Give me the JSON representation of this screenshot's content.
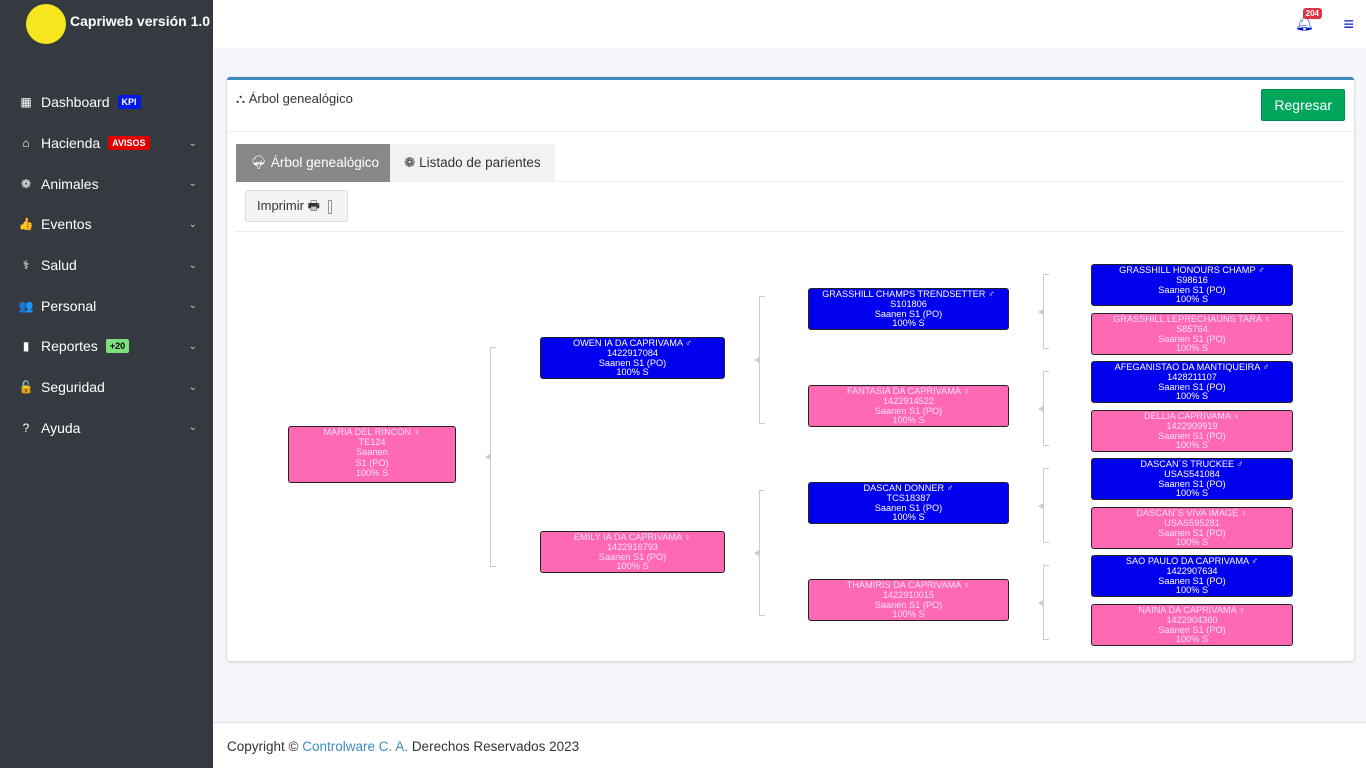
{
  "app": {
    "title": "Capriweb versión 1.0",
    "logo_text": "Capriweb"
  },
  "sidebar": {
    "items": [
      {
        "label": "Dashboard",
        "icon": "grid-icon",
        "glyph": "▦",
        "badge": "KPI",
        "badge_color": "#0019e6",
        "chev": false
      },
      {
        "label": "Hacienda",
        "icon": "home-icon",
        "glyph": "⌂",
        "badge": "AVISOS",
        "badge_color": "#e00000",
        "chev": true
      },
      {
        "label": "Animales",
        "icon": "paw-icon",
        "glyph": "❁",
        "chev": true
      },
      {
        "label": "Eventos",
        "icon": "thumbs-up-icon",
        "glyph": "👍",
        "chev": true
      },
      {
        "label": "Salud",
        "icon": "stethoscope-icon",
        "glyph": "⚕",
        "chev": true
      },
      {
        "label": "Personal",
        "icon": "users-icon",
        "glyph": "👥",
        "chev": true
      },
      {
        "label": "Reportes",
        "icon": "file-icon",
        "glyph": "▮",
        "badge": "+20",
        "badge_color": "#7ce07c",
        "chev": true
      },
      {
        "label": "Seguridad",
        "icon": "lock-icon",
        "glyph": "🔓",
        "chev": true
      },
      {
        "label": "Ayuda",
        "icon": "question-icon",
        "glyph": "?",
        "chev": true
      }
    ]
  },
  "topbar": {
    "notifications": "204"
  },
  "card": {
    "title": "Árbol genealógico",
    "back_button": "Regresar"
  },
  "tabs": {
    "tree": "Árbol genealógico",
    "relatives": "Listado de parientes"
  },
  "print_label": "Imprimir",
  "tree": {
    "nodes": [
      {
        "gen": 0,
        "name": "MARIA DEL RINCON",
        "sex": "f",
        "symbol": "♀",
        "lines": [
          "TE124",
          "Saanen",
          "S1 (PO)",
          "100% S"
        ]
      },
      {
        "gen": 1,
        "name": "OWEN IA DA CAPRIVAMA",
        "sex": "m",
        "symbol": "♂",
        "lines": [
          "1422917084",
          "Saanen S1 (PO)",
          "100% S"
        ]
      },
      {
        "gen": 1,
        "name": "EMILY IA DA CAPRIVAMA",
        "sex": "f",
        "symbol": "♀",
        "lines": [
          "1422916793",
          "Saanen S1 (PO)",
          "100% S"
        ]
      },
      {
        "gen": 2,
        "name": "GRASSHILL CHAMPS TRENDSETTER",
        "sex": "m",
        "symbol": "♂",
        "lines": [
          "S101806",
          "Saanen S1 (PO)",
          "100% S"
        ]
      },
      {
        "gen": 2,
        "name": "FANTASIA DA CAPRIVAMA",
        "sex": "f",
        "symbol": "♀",
        "lines": [
          "1422914522",
          "Saanen S1 (PO)",
          "100% S"
        ]
      },
      {
        "gen": 2,
        "name": "DASCAN DONNER",
        "sex": "m",
        "symbol": "♂",
        "lines": [
          "TCS18387",
          "Saanen S1 (PO)",
          "100% S"
        ]
      },
      {
        "gen": 2,
        "name": "THAMIRIS DA CAPRIVAMA",
        "sex": "f",
        "symbol": "♀",
        "lines": [
          "1422910015",
          "Saanen S1 (PO)",
          "100% S"
        ]
      },
      {
        "gen": 3,
        "name": "GRASSHILL HONOURS CHAMP",
        "sex": "m",
        "symbol": "♂",
        "lines": [
          "S98616",
          "Saanen S1 (PO)",
          "100% S"
        ]
      },
      {
        "gen": 3,
        "name": "GRASSHILL LEPRECHAUNS TARA",
        "sex": "f",
        "symbol": "♀",
        "lines": [
          "S85764",
          "Saanen S1 (PO)",
          "100% S"
        ]
      },
      {
        "gen": 3,
        "name": "AFEGANISTAO DA MANTIQUEIRA",
        "sex": "m",
        "symbol": "♂",
        "lines": [
          "1428211107",
          "Saanen S1 (PO)",
          "100% S"
        ]
      },
      {
        "gen": 3,
        "name": "DELLIA CAPRIVAMA",
        "sex": "f",
        "symbol": "♀",
        "lines": [
          "1422909919",
          "Saanen S1 (PO)",
          "100% S"
        ]
      },
      {
        "gen": 3,
        "name": "DASCAN´S TRUCKEE",
        "sex": "m",
        "symbol": "♂",
        "lines": [
          "USAS541084",
          "Saanen S1 (PO)",
          "100% S"
        ]
      },
      {
        "gen": 3,
        "name": "DASCAN´S VIVA IMAGE",
        "sex": "f",
        "symbol": "♀",
        "lines": [
          "USAS595281",
          "Saanen S1 (PO)",
          "100% S"
        ]
      },
      {
        "gen": 3,
        "name": "SAO PAULO DA CAPRIVAMA",
        "sex": "m",
        "symbol": "♂",
        "lines": [
          "1422907634",
          "Saanen S1 (PO)",
          "100% S"
        ]
      },
      {
        "gen": 3,
        "name": "NAINA DA CAPRIVAMA",
        "sex": "f",
        "symbol": "♀",
        "lines": [
          "1422904360",
          "Saanen S1 (PO)",
          "100% S"
        ]
      }
    ]
  },
  "footer": {
    "prefix": "Copyright ©",
    "company": "Controlware C. A.",
    "suffix": "Derechos Reservados 2023"
  }
}
